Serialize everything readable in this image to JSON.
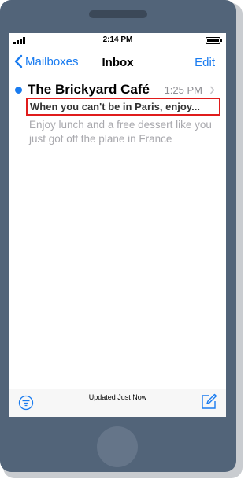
{
  "status_bar": {
    "time": "2:14 PM"
  },
  "nav": {
    "back_label": "Mailboxes",
    "title": "Inbox",
    "edit_label": "Edit"
  },
  "message": {
    "sender": "The Brickyard Café",
    "time": "1:25 PM",
    "subject": "When you can't be in Paris, enjoy...",
    "preview": "Enjoy lunch and a free dessert like you just got off the plane in France",
    "unread": true
  },
  "toolbar": {
    "status": "Updated Just Now"
  },
  "icons": [
    "signal-icon",
    "battery-icon",
    "chevron-left-icon",
    "chevron-right-icon",
    "filter-icon",
    "compose-icon"
  ],
  "colors": {
    "phone_body": "#526479",
    "accent": "#1a7cf0",
    "highlight_border": "#e01c1c",
    "preview_text": "#a8a8ad"
  }
}
